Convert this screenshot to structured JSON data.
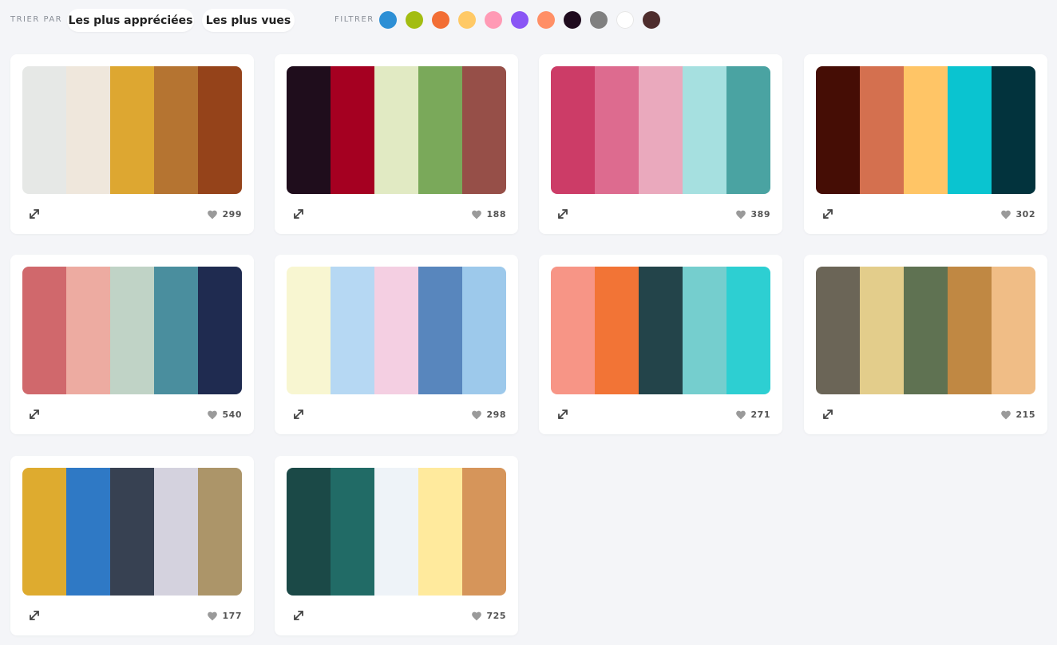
{
  "sort": {
    "label": "TRIER PAR",
    "options": [
      "Les plus appréciées",
      "Les plus vues"
    ]
  },
  "filter": {
    "label": "FILTRER",
    "colors": [
      {
        "name": "blue",
        "hex": "#2d8fd5"
      },
      {
        "name": "green",
        "hex": "#a3bd12"
      },
      {
        "name": "orange",
        "hex": "#f26e35"
      },
      {
        "name": "yellow",
        "hex": "#ffc966"
      },
      {
        "name": "pink",
        "hex": "#ff9ab5"
      },
      {
        "name": "purple",
        "hex": "#8a55f5"
      },
      {
        "name": "salmon",
        "hex": "#ff8f66"
      },
      {
        "name": "black",
        "hex": "#1f0b1e"
      },
      {
        "name": "gray",
        "hex": "#808080"
      },
      {
        "name": "white",
        "hex": "#ffffff"
      },
      {
        "name": "brown",
        "hex": "#4e2d2d"
      }
    ]
  },
  "palettes": [
    {
      "colors": [
        "#e6e8e6",
        "#efe7dc",
        "#dda731",
        "#b57431",
        "#95431a"
      ],
      "likes": "299"
    },
    {
      "colors": [
        "#1f0d1c",
        "#a50021",
        "#e1eac3",
        "#7aa95a",
        "#964f48"
      ],
      "likes": "188"
    },
    {
      "colors": [
        "#cc3c67",
        "#dd6b8f",
        "#eaa9bd",
        "#a6e0e0",
        "#4aa3a2"
      ],
      "likes": "389"
    },
    {
      "colors": [
        "#450d05",
        "#d4704f",
        "#ffc566",
        "#0ac4d0",
        "#02333d"
      ],
      "likes": "302"
    },
    {
      "colors": [
        "#d0686c",
        "#edaba1",
        "#c0d3c6",
        "#4a8e9e",
        "#1f2b50"
      ],
      "likes": "540"
    },
    {
      "colors": [
        "#f8f6d1",
        "#b6d8f3",
        "#f4cfe2",
        "#5886bd",
        "#9dc9eb"
      ],
      "likes": "298"
    },
    {
      "colors": [
        "#f79586",
        "#f27436",
        "#23444a",
        "#75cece",
        "#2dcfd2"
      ],
      "likes": "271"
    },
    {
      "colors": [
        "#6b6557",
        "#e3cd8b",
        "#5f7252",
        "#c08843",
        "#f0bd86"
      ],
      "likes": "215"
    },
    {
      "colors": [
        "#deab2f",
        "#2f79c5",
        "#374152",
        "#d4d2de",
        "#ac9569"
      ],
      "likes": "177"
    },
    {
      "colors": [
        "#1b4947",
        "#216b66",
        "#eef3f8",
        "#ffea9d",
        "#d6955a"
      ],
      "likes": "725"
    }
  ]
}
